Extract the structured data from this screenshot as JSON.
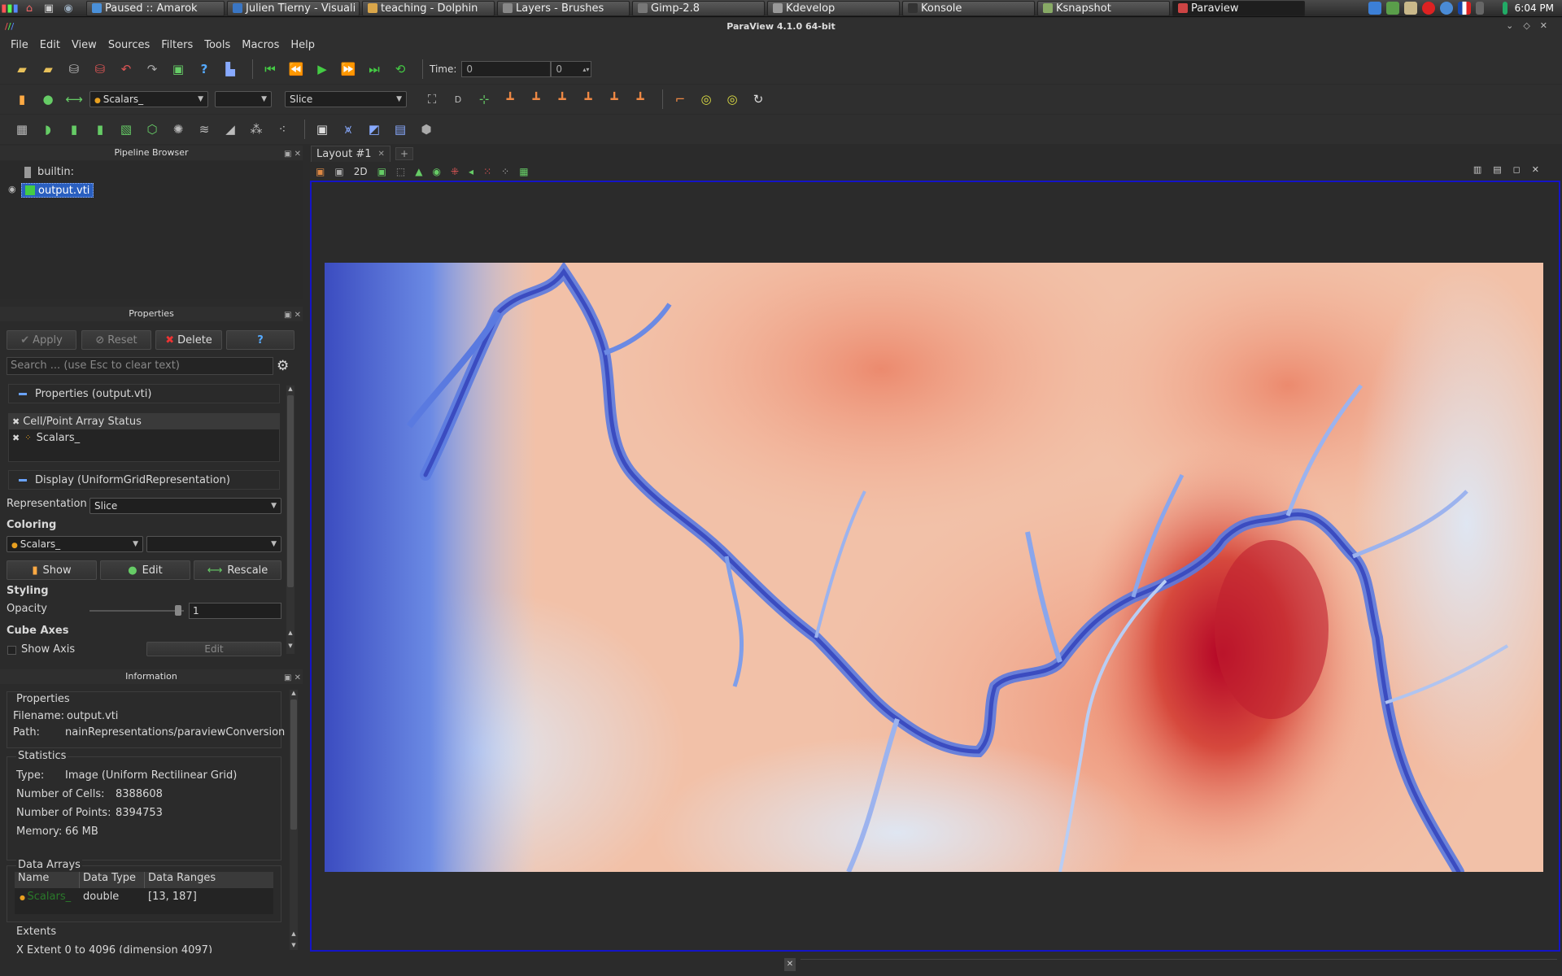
{
  "taskbar": {
    "tasks": [
      {
        "label": "Paused  ::  Amarok",
        "color": "#4a90d9",
        "width": 170
      },
      {
        "label": "Julien Tierny - Visuali",
        "color": "#3a76c4",
        "width": 163
      },
      {
        "label": "teaching - Dolphin",
        "color": "#d9a64a",
        "width": 163
      },
      {
        "label": "Layers - Brushes",
        "color": "#888888",
        "width": 163
      },
      {
        "label": "Gimp-2.8",
        "color": "#777777",
        "width": 163
      },
      {
        "label": "Kdevelop",
        "color": "#999999",
        "width": 163
      },
      {
        "label": "Konsole",
        "color": "#333333",
        "width": 163
      },
      {
        "label": "Ksnapshot",
        "color": "#88aa66",
        "width": 163
      },
      {
        "label": "Paraview",
        "color": "#cc4444",
        "width": 163,
        "active": true
      }
    ],
    "clock": "6:04 PM"
  },
  "window": {
    "title": "ParaView 4.1.0 64-bit"
  },
  "menu": [
    "File",
    "Edit",
    "View",
    "Sources",
    "Filters",
    "Tools",
    "Macros",
    "Help"
  ],
  "toolbar": {
    "time_label": "Time:",
    "time_value": "0",
    "time_index": "0",
    "color_array": "Scalars_",
    "component": "",
    "representation": "Slice"
  },
  "pipeline": {
    "title": "Pipeline Browser",
    "builtin": "builtin:",
    "source": "output.vti"
  },
  "properties": {
    "title": "Properties",
    "apply": "Apply",
    "reset": "Reset",
    "delete": "Delete",
    "help": "?",
    "search_placeholder": "Search ... (use Esc to clear text)",
    "section_props": "Properties (output.vti)",
    "array_status_header": "Cell/Point Array Status",
    "array_name": "Scalars_",
    "section_display": "Display (UniformGridRepresentation)",
    "representation_label": "Representation",
    "representation_value": "Slice",
    "coloring_label": "Coloring",
    "coloring_value": "Scalars_",
    "coloring_component": "",
    "show_btn": "Show",
    "edit_btn": "Edit",
    "rescale_btn": "Rescale",
    "styling_label": "Styling",
    "opacity_label": "Opacity",
    "opacity_value": "1",
    "cube_axes_label": "Cube Axes",
    "show_axis_label": "Show Axis",
    "axis_edit": "Edit"
  },
  "information": {
    "title": "Information",
    "properties_header": "Properties",
    "filename_label": "Filename:",
    "filename_value": "output.vti",
    "path_label": "Path:",
    "path_value": "nainRepresentations/paraviewConversion",
    "statistics_header": "Statistics",
    "type_label": "Type:",
    "type_value": "Image (Uniform Rectilinear Grid)",
    "cells_label": "Number of Cells:",
    "cells_value": "8388608",
    "points_label": "Number of Points:",
    "points_value": "8394753",
    "memory_label": "Memory:",
    "memory_value": "66 MB",
    "data_arrays_header": "Data Arrays",
    "col_name": "Name",
    "col_type": "Data Type",
    "col_ranges": "Data Ranges",
    "row_name": "Scalars_",
    "row_type": "double",
    "row_range": "[13, 187]",
    "extents_header": "Extents",
    "x_extent": "X Extent   0 to 4096 (dimension 4097)"
  },
  "layout": {
    "tab": "Layout #1",
    "mode_2d": "2D"
  },
  "colors": {
    "panel_bg": "#2b2b2b",
    "frame": "#1414c8",
    "cold": "#3b4cc0",
    "warm": "#b40426"
  }
}
